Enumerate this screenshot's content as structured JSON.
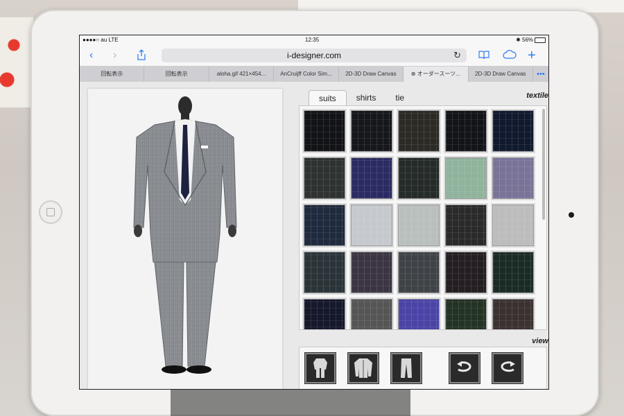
{
  "status_bar": {
    "carrier": "●●●●○ au  LTE",
    "time": "12:35",
    "battery": "✱ 56%"
  },
  "browser": {
    "url": "i-designer.com",
    "icons": [
      "back-icon",
      "forward-icon",
      "share-icon",
      "reload-icon",
      "bookmarks-icon",
      "cloud-icon",
      "add-tab-icon"
    ],
    "tabs": [
      {
        "label": "回転表示",
        "active": false
      },
      {
        "label": "回転表示",
        "active": false
      },
      {
        "label": "aloha.gif 421×454...",
        "active": false
      },
      {
        "label": "AnCruijff Color Sim...",
        "active": false
      },
      {
        "label": "2D-3D Draw Canvas",
        "active": false
      },
      {
        "label": "⊗  オーダースーツ...",
        "active": true
      },
      {
        "label": "2D-3D Draw Canvas",
        "active": false
      }
    ],
    "more_tabs": "•••"
  },
  "app": {
    "category_tabs": [
      {
        "label": "suits",
        "active": true
      },
      {
        "label": "shirts",
        "active": false
      },
      {
        "label": "tie",
        "active": false
      }
    ],
    "textile_label": "textile",
    "view_label": "view",
    "swatches": [
      [
        "#121316",
        "#16171b",
        "#2c2a24",
        "#131418",
        "#10192e"
      ],
      [
        "#2e3331",
        "#2b2b63",
        "#252b28",
        "#8fb39c",
        "#7a7398"
      ],
      [
        "#1f2a3e",
        "#c5c8cd",
        "#b9bfbc",
        "#2a2a2a",
        "#bcbcbc"
      ],
      [
        "#2a3438",
        "#3b3442",
        "#3f4347",
        "#241e22",
        "#1a2b26"
      ],
      [
        "#15172b",
        "#555555",
        "#4a44a6",
        "#233324",
        "#3a3131"
      ]
    ],
    "view_buttons": [
      "front-view-icon",
      "jacket-view-icon",
      "trousers-view-icon",
      "rotate-left-icon",
      "rotate-right-icon"
    ]
  }
}
